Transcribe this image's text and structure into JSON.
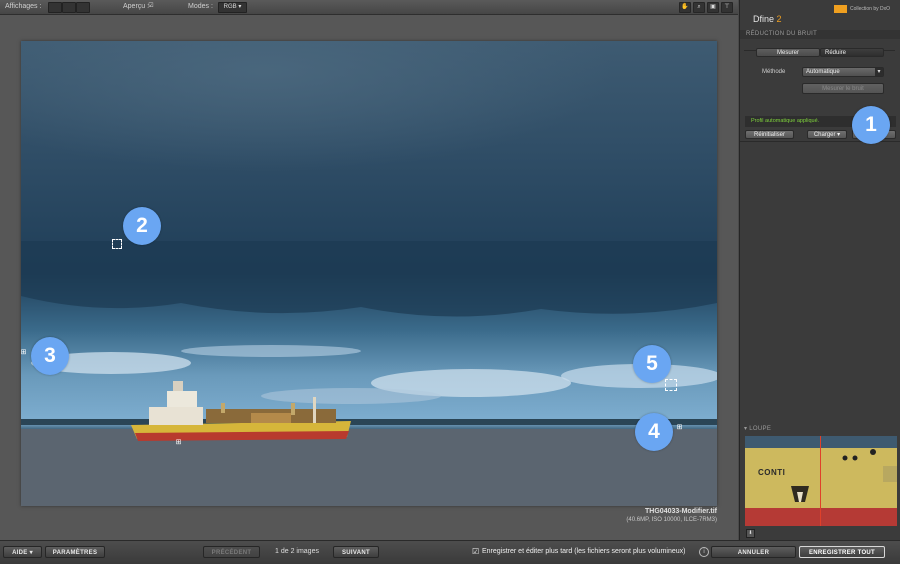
{
  "toolbar": {
    "affichages_label": "Affichages :",
    "apercu_label": "Aperçu :",
    "modes_label": "Modes :",
    "mode_value": "RGB"
  },
  "image": {
    "filename": "THG04033-Modifier.tif",
    "info": "(40.6MP, ISO 10000, ILCE-7RM3)"
  },
  "panel": {
    "brand_name": "Dfine",
    "brand_version": "2",
    "brand_tag": "Collection by DxO",
    "section_title": "RÉDUCTION DU BRUIT",
    "tabs": [
      "Mesurer",
      "Réduire"
    ],
    "method_label": "Méthode",
    "method_value": "Automatique",
    "measure_button": "Mesurer le bruit",
    "status_text": "Profil automatique appliqué.",
    "reset_button": "Réinitialiser",
    "load_button": "Charger",
    "loupe_title": "LOUPE",
    "loupe_text": "CONTI"
  },
  "bottom": {
    "help_button": "AIDE ▾",
    "settings_button": "PARAMÈTRES",
    "prev_button": "PRÉCÉDENT",
    "counter": "1 de 2 images",
    "next_button": "SUIVANT",
    "save_later_text": "Enregistrer et éditer plus tard (les fichiers seront plus volumineux)",
    "cancel_button": "ANNULER",
    "save_all_button": "ENREGISTRER TOUT"
  },
  "markers": [
    "1",
    "2",
    "3",
    "4",
    "5"
  ],
  "colors": {
    "accent_orange": "#f0a020",
    "status_green": "#7fd23c",
    "marker_blue": "#6aa6f2"
  }
}
